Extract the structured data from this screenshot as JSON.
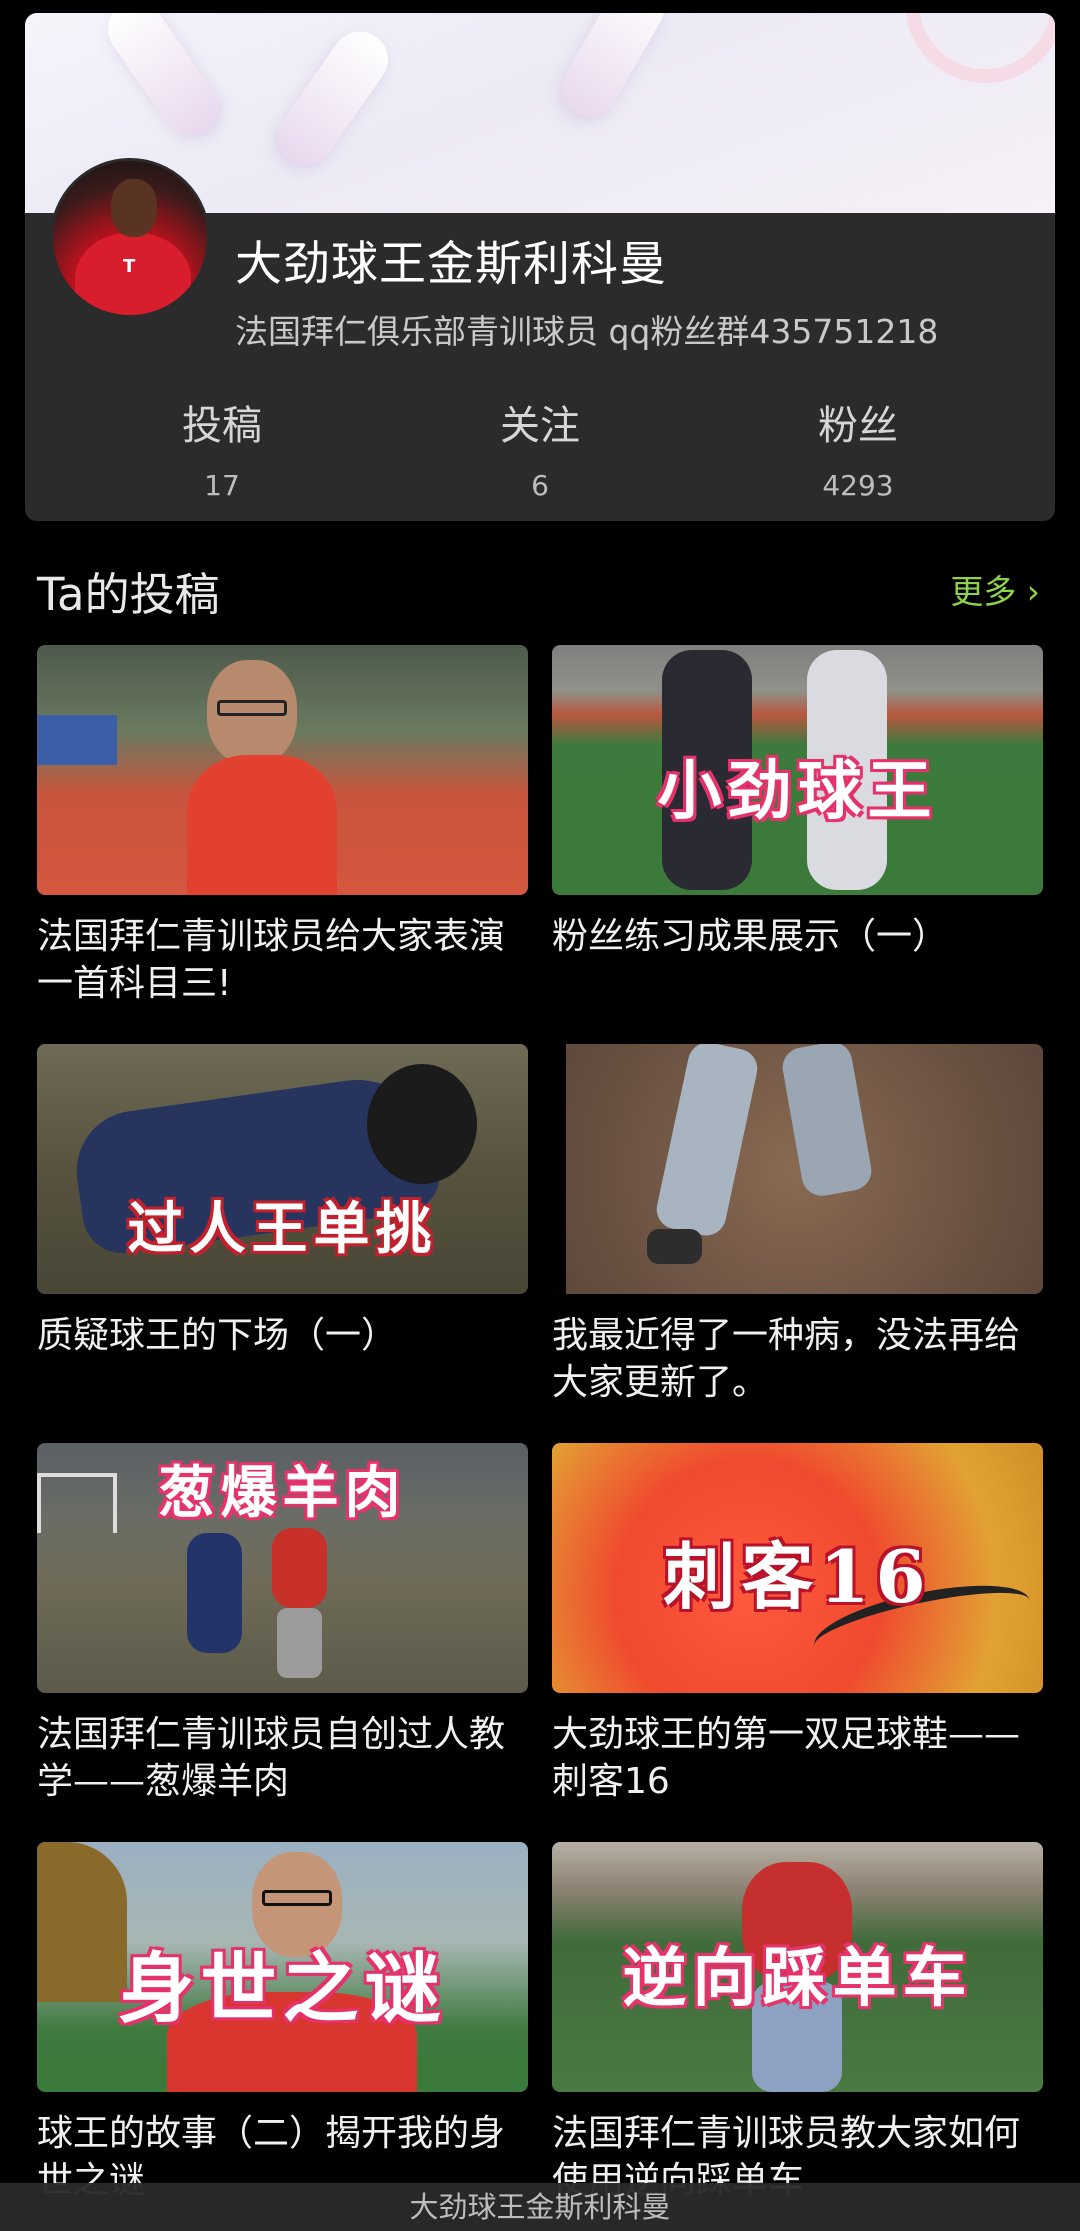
{
  "profile": {
    "name": "大劲球王金斯利科曼",
    "bio": "法国拜仁俱乐部青训球员 qq粉丝群435751218",
    "stats": [
      {
        "label": "投稿",
        "value": "17"
      },
      {
        "label": "关注",
        "value": "6"
      },
      {
        "label": "粉丝",
        "value": "4293"
      }
    ]
  },
  "section": {
    "title": "Ta的投稿",
    "more_label": "更多 ›"
  },
  "posts": [
    {
      "caption": "法国拜仁青训球员给大家表演一首科目三!",
      "overlay": ""
    },
    {
      "caption": "粉丝练习成果展示（一）",
      "overlay": "小劲球王"
    },
    {
      "caption": "质疑球王的下场（一）",
      "overlay": "过人王单挑"
    },
    {
      "caption": "我最近得了一种病，没法再给大家更新了。",
      "overlay": ""
    },
    {
      "caption": "法国拜仁青训球员自创过人教学——葱爆羊肉",
      "overlay": "葱爆羊肉"
    },
    {
      "caption": "大劲球王的第一双足球鞋——刺客16",
      "overlay": "刺客16"
    },
    {
      "caption": "球王的故事（二）揭开我的身世之谜",
      "overlay": "身世之谜"
    },
    {
      "caption": "法国拜仁青训球员教大家如何使用逆向踩单车",
      "overlay": "逆向踩单车"
    }
  ],
  "bottom_bar": {
    "title": "大劲球王金斯利科曼"
  }
}
